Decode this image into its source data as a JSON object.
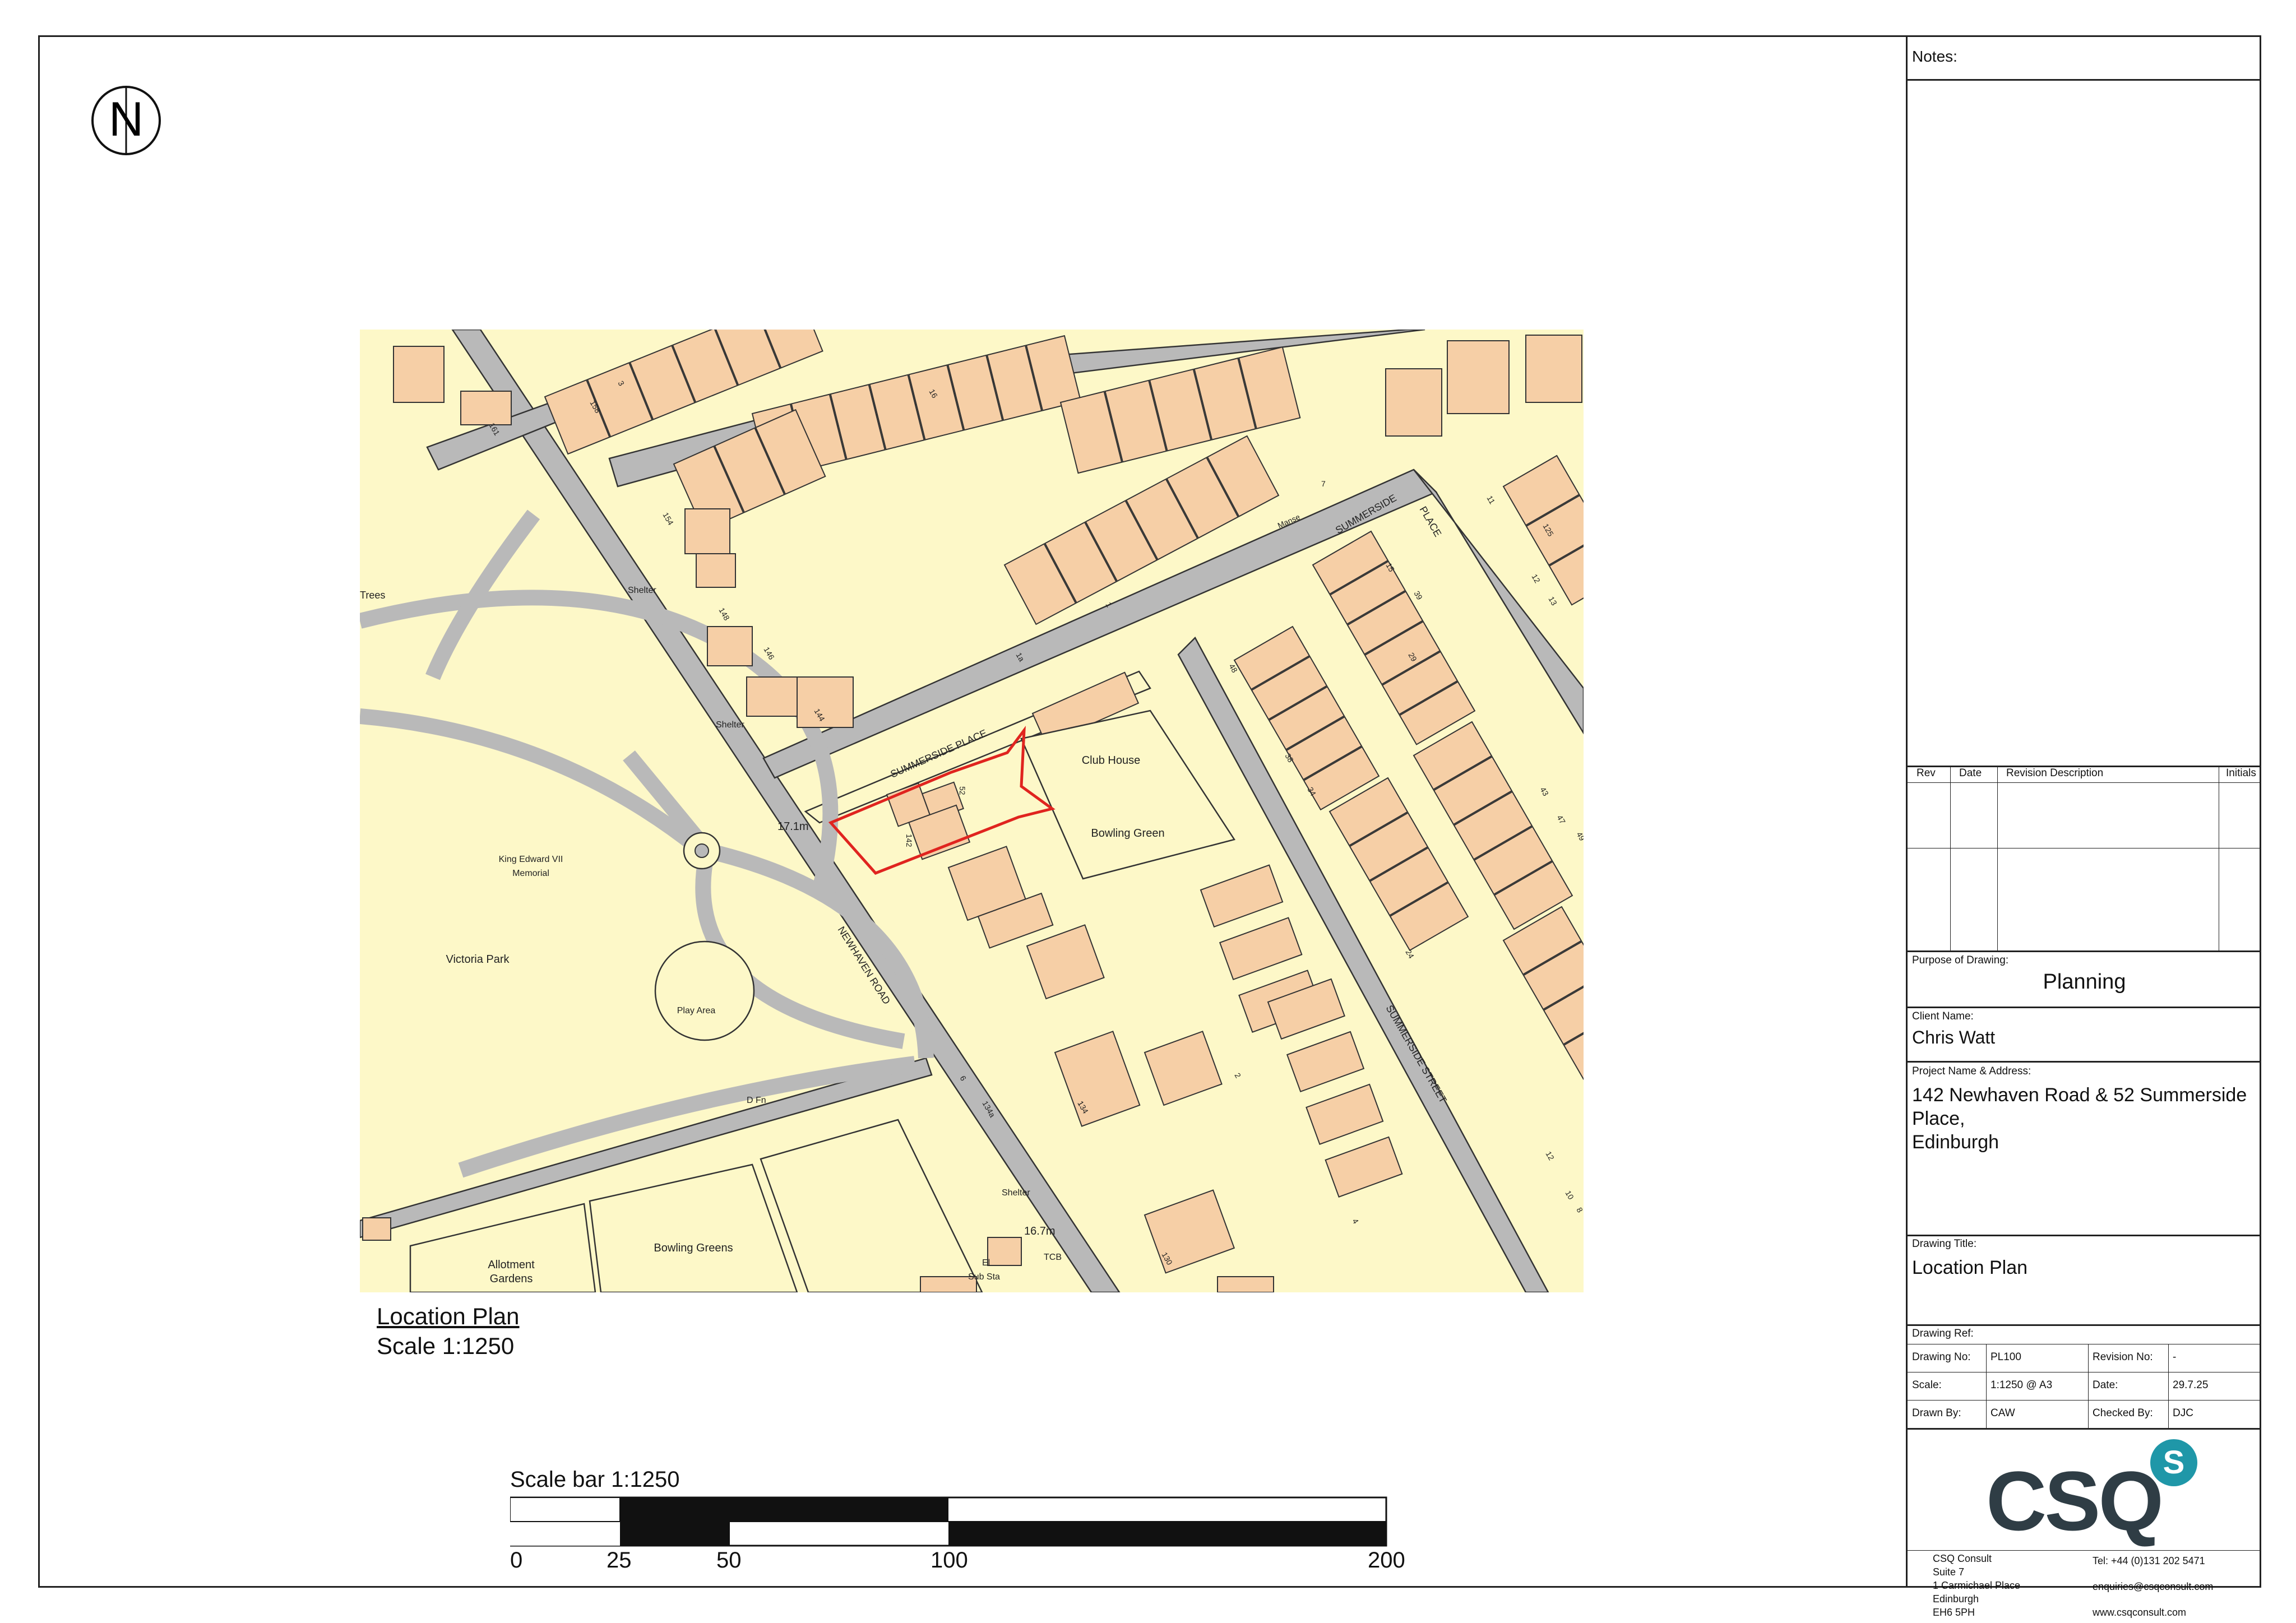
{
  "plan": {
    "title": "Location Plan",
    "scale": "Scale 1:1250"
  },
  "scalebar": {
    "title": "Scale bar 1:1250",
    "labels": [
      "0",
      "25",
      "50",
      "100",
      "200"
    ]
  },
  "north_arrow": {
    "letter": "N",
    "icon": "north-arrow-icon"
  },
  "map_labels": {
    "trees": "Trees",
    "shelter1": "Shelter",
    "shelter2": "Shelter",
    "shelter3": "Shelter",
    "memorial": "King Edward VII",
    "memorial2": "Memorial",
    "park": "Victoria Park",
    "play": "Play Area",
    "dfn": "D Fn",
    "allotment": "Allotment",
    "allotment2": "Gardens",
    "bowling_greens": "Bowling Greens",
    "summerside_place_road": "SUMMERSIDE PLACE",
    "summerside_place_ne": "SUMMERSIDE",
    "summerside_place_ne2": "PLACE",
    "summerside_street": "SUMMERSIDE STREET",
    "newhaven_road": "NEWHAVEN ROAD",
    "club_house": "Club House",
    "bowling_green": "Bowling Green",
    "level1": "17.1m",
    "level2": "16.7m",
    "tcb": "TCB",
    "el": "El",
    "substa": "Sub Sta",
    "manse": "Manse",
    "n142": "142",
    "n52": "52",
    "n144": "144",
    "n146": "146",
    "n148": "148",
    "n154": "154",
    "n158": "158",
    "n161": "161",
    "n134a": "134a",
    "n134": "134",
    "n130": "130",
    "n48": "48",
    "n38": "38",
    "n34": "34",
    "n24": "24",
    "n39": "39",
    "n29": "29",
    "n49": "49",
    "n43": "43",
    "n47": "47",
    "n15": "15",
    "n12": "12",
    "n10": "10",
    "n11": "11",
    "n13": "13",
    "n7": "7",
    "n2": "2",
    "n4": "4",
    "n3": "3",
    "n1": "1",
    "n6": "6",
    "n1b": "1",
    "n125": "125",
    "n12b": "12",
    "n8": "8",
    "n1a": "1a",
    "n16": "16"
  },
  "titleblock": {
    "notes_label": "Notes:",
    "rev_headers": [
      "Rev",
      "Date",
      "Revision Description",
      "Initials"
    ],
    "purpose_label": "Purpose of Drawing:",
    "purpose_value": "Planning",
    "client_label": "Client Name:",
    "client_value": "Chris Watt",
    "project_label": "Project Name & Address:",
    "project_line1": "142 Newhaven Road & 52 Summerside",
    "project_line2": "Place,",
    "project_line3": "Edinburgh",
    "drawing_title_label": "Drawing Title:",
    "drawing_title_value": "Location Plan",
    "drawing_ref_label": "Drawing Ref:",
    "drawing_no_label": "Drawing No:",
    "drawing_no_value": "PL100",
    "revision_no_label": "Revision No:",
    "revision_no_value": "-",
    "scale_label": "Scale:",
    "scale_value": "1:1250 @ A3",
    "date_label": "Date:",
    "date_value": "29.7.25",
    "drawn_by_label": "Drawn By:",
    "drawn_by_value": "CAW",
    "checked_by_label": "Checked By:",
    "checked_by_value": "DJC",
    "logo_text": "CSQ",
    "logo_badge": "S",
    "address_lines": [
      "CSQ Consult",
      "Suite 7",
      "1 Carmichael Place",
      "Edinburgh",
      "EH6 5PH"
    ],
    "tel": "Tel: +44 (0)131 202 5471",
    "email": "enquiries@csqconsult.com",
    "web": "www.csqconsult.com"
  },
  "colors": {
    "land": "#fdf8c8",
    "building": "#f6cfa6",
    "road": "#b9b9b9",
    "site_outline": "#e0241f",
    "brand_dark": "#2f3d45",
    "brand_teal": "#1f97a8"
  }
}
